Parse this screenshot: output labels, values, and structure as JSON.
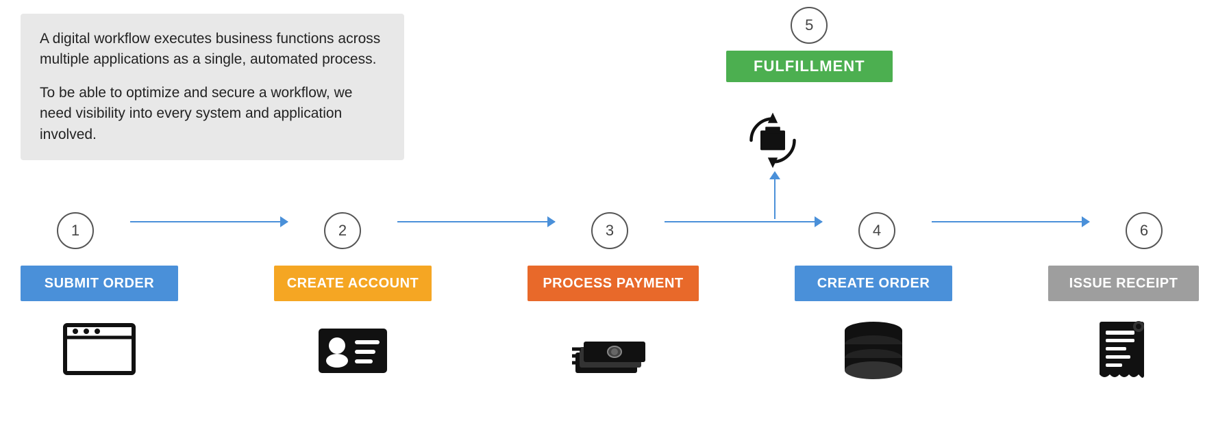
{
  "description": {
    "para1": "A digital workflow executes business functions across multiple applications as a single, automated process.",
    "para2": "To be able to optimize and secure a workflow, we need visibility into every system and application involved."
  },
  "fulfillment": {
    "step_number": "5",
    "label": "FULFILLMENT",
    "color": "#4caf50"
  },
  "steps": [
    {
      "number": "1",
      "label": "SUBMIT ORDER",
      "color": "#4a90d9"
    },
    {
      "number": "2",
      "label": "CREATE ACCOUNT",
      "color": "#f5a623"
    },
    {
      "number": "3",
      "label": "PROCESS PAYMENT",
      "color": "#e8692a"
    },
    {
      "number": "4",
      "label": "CREATE ORDER",
      "color": "#4a90d9"
    },
    {
      "number": "6",
      "label": "ISSUE RECEIPT",
      "color": "#9e9e9e"
    }
  ]
}
